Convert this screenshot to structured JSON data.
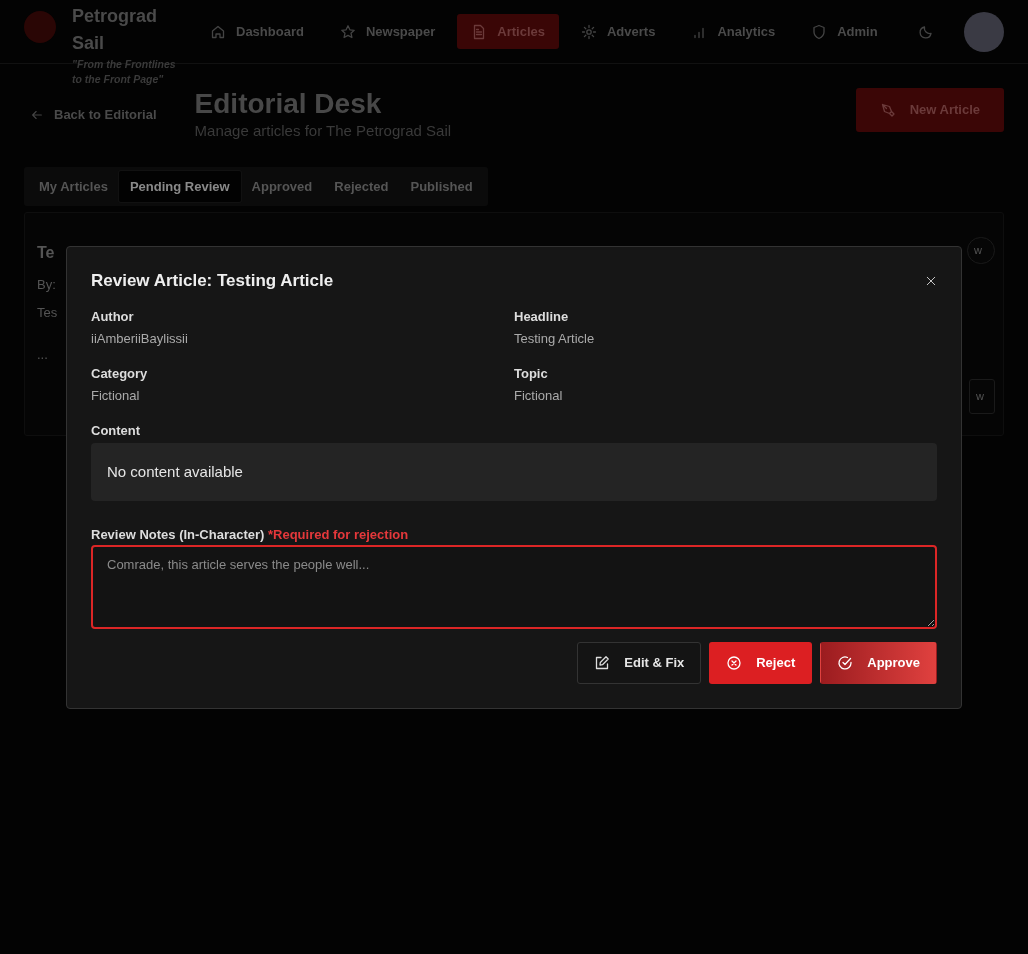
{
  "navbar": {
    "brand": "Petrograd Sail",
    "tagline": "\"From the Frontlines to the Front Page\"",
    "items": [
      {
        "label": "Dashboard",
        "kind": "home",
        "selected": false
      },
      {
        "label": "Newspaper",
        "kind": "star",
        "selected": false
      },
      {
        "label": "Articles",
        "kind": "document",
        "selected": true
      },
      {
        "label": "Adverts",
        "kind": "gear",
        "selected": false
      },
      {
        "label": "Analytics",
        "kind": "bars",
        "selected": false
      },
      {
        "label": "Admin",
        "kind": "shield",
        "selected": false
      }
    ]
  },
  "header": {
    "back_link": "Back to Editorial",
    "title": "Editorial Desk",
    "subtitle": "Manage articles for The Petrograd Sail",
    "new_button": "New Article"
  },
  "tabs": [
    {
      "label": "My Articles",
      "selected": false
    },
    {
      "label": "Pending Review",
      "selected": true
    },
    {
      "label": "Approved",
      "selected": false
    },
    {
      "label": "Rejected",
      "selected": false
    },
    {
      "label": "Published",
      "selected": false
    }
  ],
  "article_card": {
    "title": "Te",
    "byline": "By:",
    "excerpt": "Tes",
    "more": "...",
    "buttons": [
      "w",
      "w"
    ]
  },
  "modal": {
    "title": "Review Article: Testing Article",
    "fields": [
      {
        "label": "Author",
        "value": "iiAmberiiBaylissii"
      },
      {
        "label": "Headline",
        "value": "Testing Article"
      },
      {
        "label": "Category",
        "value": "Fictional"
      },
      {
        "label": "Topic",
        "value": "Fictional"
      }
    ],
    "content_label": "Content",
    "content": "No content available",
    "notes": {
      "label": "Review Notes (In-Character)",
      "required_note": "*Required for rejection",
      "placeholder": "Comrade, this article serves the people well...",
      "invalid": true
    },
    "actions": [
      {
        "label": "Edit & Fix",
        "kind": "edit"
      },
      {
        "label": "Reject",
        "kind": "reject"
      },
      {
        "label": "Approve",
        "kind": "approve"
      }
    ]
  }
}
